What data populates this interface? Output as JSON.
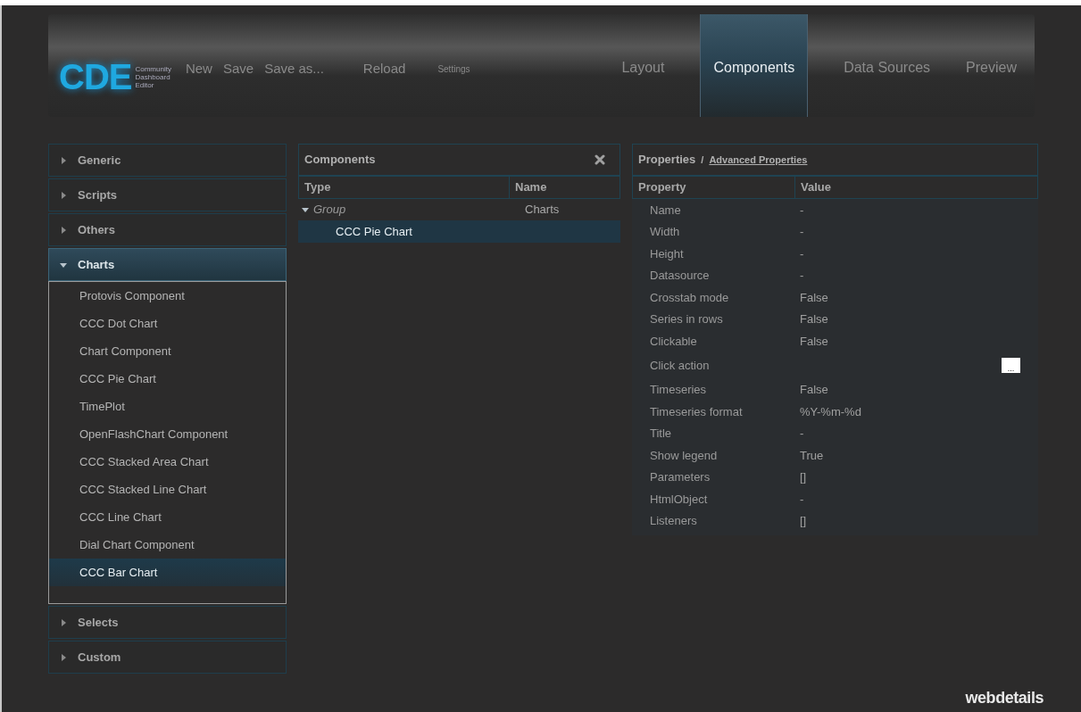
{
  "header": {
    "logo": "CDE",
    "logo_caption": [
      "Community",
      "Dashboard",
      "Editor"
    ],
    "menu": [
      {
        "label": "New",
        "kind": "main"
      },
      {
        "label": "Save",
        "kind": "main"
      },
      {
        "label": "Save as...",
        "kind": "main"
      },
      {
        "label": "Reload",
        "kind": "main"
      },
      {
        "label": "Settings",
        "kind": "small"
      }
    ],
    "tabs": [
      {
        "label": "Layout",
        "selected": false
      },
      {
        "label": "Components",
        "selected": true
      },
      {
        "label": "Data Sources",
        "selected": false
      },
      {
        "label": "Preview",
        "selected": false
      }
    ]
  },
  "palette": [
    {
      "label": "Generic",
      "expanded": false
    },
    {
      "label": "Scripts",
      "expanded": false
    },
    {
      "label": "Others",
      "expanded": false
    },
    {
      "label": "Charts",
      "expanded": true,
      "items": [
        {
          "label": "Protovis Component",
          "selected": false
        },
        {
          "label": "CCC Dot Chart",
          "selected": false
        },
        {
          "label": "Chart Component",
          "selected": false
        },
        {
          "label": "CCC Pie Chart",
          "selected": false
        },
        {
          "label": "TimePlot",
          "selected": false
        },
        {
          "label": "OpenFlashChart Component",
          "selected": false
        },
        {
          "label": "CCC Stacked Area Chart",
          "selected": false
        },
        {
          "label": "CCC Stacked Line Chart",
          "selected": false
        },
        {
          "label": "CCC Line Chart",
          "selected": false
        },
        {
          "label": "Dial Chart Component",
          "selected": false
        },
        {
          "label": "CCC Bar Chart",
          "selected": true
        }
      ]
    },
    {
      "label": "Selects",
      "expanded": false
    },
    {
      "label": "Custom",
      "expanded": false
    }
  ],
  "components": {
    "title": "Components",
    "columns": [
      "Type",
      "Name"
    ],
    "tree": [
      {
        "type": "Group",
        "name": "Charts",
        "expanded": true,
        "selected": false,
        "children": [
          {
            "type": "CCC Pie Chart",
            "selected": true
          }
        ]
      }
    ]
  },
  "properties": {
    "title": "Properties",
    "separator": "/",
    "link": "Advanced Properties",
    "columns": [
      "Property",
      "Value"
    ],
    "rows": [
      {
        "property": "Name",
        "value": "-",
        "kind": "text"
      },
      {
        "property": "Width",
        "value": "-",
        "kind": "text"
      },
      {
        "property": "Height",
        "value": "-",
        "kind": "text"
      },
      {
        "property": "Datasource",
        "value": "-",
        "kind": "text"
      },
      {
        "property": "Crosstab mode",
        "value": "False",
        "kind": "text"
      },
      {
        "property": "Series in rows",
        "value": "False",
        "kind": "text"
      },
      {
        "property": "Clickable",
        "value": "False",
        "kind": "text"
      },
      {
        "property": "Click action",
        "value": "...",
        "kind": "button"
      },
      {
        "property": "Timeseries",
        "value": "False",
        "kind": "text"
      },
      {
        "property": "Timeseries format",
        "value": "%Y-%m-%d",
        "kind": "text"
      },
      {
        "property": "Title",
        "value": "-",
        "kind": "text"
      },
      {
        "property": "Show legend",
        "value": "True",
        "kind": "text"
      },
      {
        "property": "Parameters",
        "value": "[]",
        "kind": "text"
      },
      {
        "property": "HtmlObject",
        "value": "-",
        "kind": "text"
      },
      {
        "property": "Listeners",
        "value": "[]",
        "kind": "text"
      }
    ]
  },
  "footer": {
    "brand": "webdetails"
  }
}
